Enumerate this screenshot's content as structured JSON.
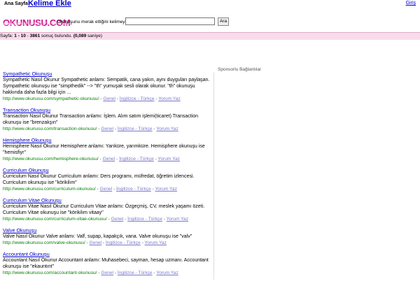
{
  "nav": {
    "home": "Ana Sayfa",
    "add_word": "Kelime Ekle",
    "login": "Giriş"
  },
  "header": {
    "logo_text": "OKUNUSU.COM",
    "search_label": "Okunuşunu merak ettiğini kelimeyi giriniz:",
    "search_value": "",
    "search_button": "Ara"
  },
  "results_bar": {
    "prefix": "Sayfa: ",
    "range": "1 - 10",
    "sep": " - ",
    "total": "3861",
    "found_text": " sonuç bulundu. ",
    "time": "(0,089",
    "time_suffix": " saniye)"
  },
  "sponsor_label": "Sponsorlu Bağlantılar",
  "results": [
    {
      "title": "Sympathetic Okunuşu",
      "snippet": "Sympathetic Nasıl Okunur Sympathetic anlamı: Sempatik, cana yakın, aynı duyguları paylaşan. Sympathetic okunuşu ise \"simpthedik\" --> \"th\" yumuşak sesli olarak okunur. \"th\" okunuşu hakkında daha fazla bilgi için ...",
      "url": "http://www.okunusu.com/sympathetic-okunusu/",
      "cat1": "Genel",
      "cat2": "İngilizce - Türkçe",
      "cat3": "Yorum Yaz"
    },
    {
      "title": "Transaction Okunuşu",
      "snippet": "Transaction Nasıl Okunur Transaction anlamı: İşlem. Alım satım işlemi(ticaret) Transaction okunuşu ise \"brenzakşın\"",
      "url": "http://www.okunusu.com/transaction-okunusu/",
      "cat1": "Genel",
      "cat2": "İngilizce - Türkçe",
      "cat3": "Yorum Yaz"
    },
    {
      "title": "Hemisphere Okunuşu",
      "snippet": "Hemisphere Nasıl Okunur Hemisphere anlamı: Yarıküre, yarımküre. Hemisphere okunuşu ise \"hemisfiyr\"",
      "url": "http://www.okunusu.com/hemisphere-okunusu/",
      "cat1": "Genel",
      "cat2": "İngilizce - Türkçe",
      "cat3": "Yorum Yaz"
    },
    {
      "title": "Curriculum Okunuşu",
      "snippet": "Curriculum Nasıl Okunur Curriculum anlamı: Ders programı, müfredat, öğretim izlencesi. Curriculum okunuşu ise \"körikilım\"",
      "url": "http://www.okunusu.com/curriculum-okunusu/",
      "cat1": "Genel",
      "cat2": "İngilizce - Türkçe",
      "cat3": "Yorum Yaz"
    },
    {
      "title": "Curriculum Vitae Okunuşu",
      "snippet": "Curriculum Vitae Nasıl Okunur Curriculum Vitae anlamı: Özgeçmiş, CV, meslek yaşamı özeti. Curriculum Vitae okunuşu ise \"körikilım vitaay\"",
      "url": "http://www.okunusu.com/curriculum-vitae-okunusu/",
      "cat1": "Genel",
      "cat2": "İngilizce - Türkçe",
      "cat3": "Yorum Yaz"
    },
    {
      "title": "Valve Okunuşu",
      "snippet": "Valve Nasıl Okunur Valve anlamı: Valf, supap, kapakçık, vana. Valve okunuşu ise \"valv\"",
      "url": "http://www.okunusu.com/valve-okunusu/",
      "cat1": "Genel",
      "cat2": "İngilizce - Türkçe",
      "cat3": "Yorum Yaz"
    },
    {
      "title": "Accountant Okunuşu",
      "snippet": "Accountant Nasıl Okunur Accountant anlamı: Muhasebeci, sayman, hesap uzmanı. Accountant okunuşu ise \"ekauntınt\"",
      "url": "http://www.okunusu.com/accountant-okunusu/",
      "cat1": "Genel",
      "cat2": "İngilizce - Türkçe",
      "cat3": "Yorum Yaz"
    }
  ]
}
